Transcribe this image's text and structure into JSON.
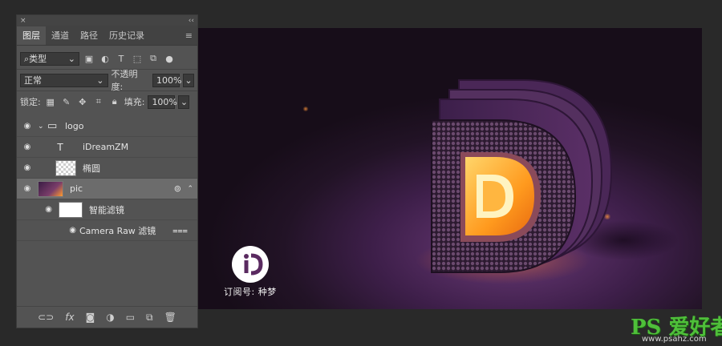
{
  "panel": {
    "close": "×",
    "collapse": "‹‹",
    "tabs": [
      {
        "label": "图层",
        "active": true
      },
      {
        "label": "通道",
        "active": false
      },
      {
        "label": "路径",
        "active": false
      },
      {
        "label": "历史记录",
        "active": false
      }
    ],
    "menu_icon": "menu-icon",
    "filter": {
      "label": "类型",
      "icons": [
        "image-filter-icon",
        "adjustment-filter-icon",
        "type-filter-icon",
        "shape-filter-icon",
        "smart-object-filter-icon"
      ]
    },
    "blend_mode": "正常",
    "opacity_label": "不透明度:",
    "opacity_value": "100%",
    "lock_label": "锁定:",
    "fill_label": "填充:",
    "fill_value": "100%",
    "layers": [
      {
        "name": "logo",
        "type": "group",
        "visible": true
      },
      {
        "name": "iDreamZM",
        "type": "text",
        "visible": true
      },
      {
        "name": "椭圆",
        "type": "shape",
        "visible": true
      },
      {
        "name": "pic",
        "type": "smart-object",
        "visible": true,
        "selected": true
      },
      {
        "name": "智能滤镜",
        "type": "smart-filter",
        "visible": true
      },
      {
        "name": "Camera Raw 滤镜",
        "type": "filter",
        "visible": true
      }
    ],
    "bottom_icons": [
      "link-icon",
      "fx-icon",
      "mask-icon",
      "adjustment-icon",
      "folder-icon",
      "new-layer-icon",
      "trash-icon"
    ]
  },
  "document": {
    "caption": "订阅号: 种梦"
  },
  "watermark": {
    "text": "PS 爱好者",
    "url": "www.psahz.com",
    "color": "#4fbf3a"
  }
}
